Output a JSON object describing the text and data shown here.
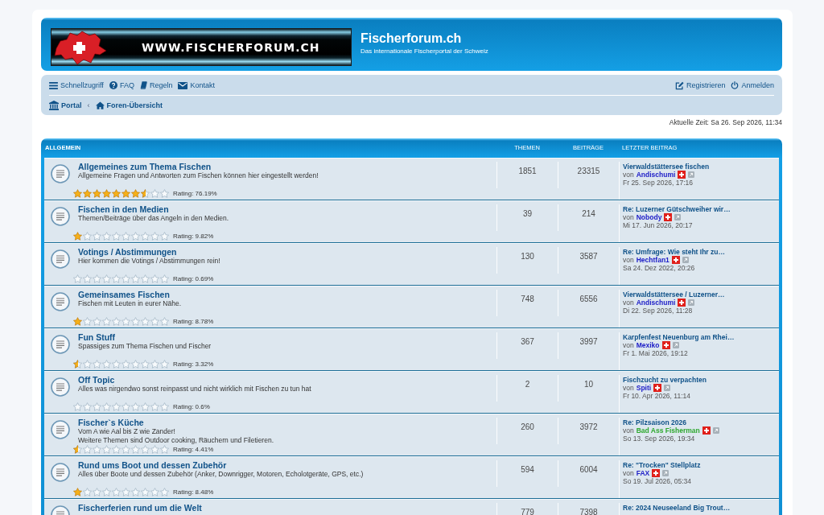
{
  "header": {
    "logo_text": "WWW.FISCHERFORUM.CH",
    "site_title": "Fischerforum.ch",
    "site_description": "Das internationale Fischerportal der Schweiz"
  },
  "navbar": {
    "left_links": [
      {
        "kind": "menu",
        "label": "Schnellzugriff"
      },
      {
        "kind": "faq",
        "label": "FAQ"
      },
      {
        "kind": "rules",
        "label": "Regeln"
      },
      {
        "kind": "contact",
        "label": "Kontakt"
      }
    ],
    "right_links": [
      {
        "kind": "register",
        "label": "Registrieren"
      },
      {
        "kind": "login",
        "label": "Anmelden"
      }
    ],
    "breadcrumbs": [
      {
        "kind": "portal",
        "label": "Portal"
      },
      {
        "kind": "home",
        "label": "Foren-Übersicht"
      }
    ],
    "breadcrumb_separator": "‹"
  },
  "current_time": "Aktuelle Zeit: Sa 26. Sep 2026, 11:34",
  "forum_list": {
    "category": "ALLGEMEIN",
    "columns": [
      "THEMEN",
      "BEITRÄGE",
      "LETZTER BEITRAG"
    ],
    "forums": [
      {
        "title": "Allgemeines zum Thema Fischen",
        "description": [
          "Allgemeine Fragen und Antworten zum Fischen können hier eingestellt werden!"
        ],
        "stars": 7.5,
        "rating": "Rating: 76.19%",
        "topics": "1851",
        "posts": "23315",
        "last_post": {
          "title": "Vierwaldstättersee fischen",
          "by": "von",
          "author": {
            "name": "Andischumi",
            "color": "#2020c8"
          },
          "date": "Fr 25. Sep 2026, 17:16"
        }
      },
      {
        "title": "Fischen in den Medien",
        "description": [
          "Themen/Beiträge über das Angeln in den Medien."
        ],
        "stars": 1,
        "rating": "Rating: 9.82%",
        "topics": "39",
        "posts": "214",
        "last_post": {
          "title": "Re: Luzerner Gütschweiher wir…",
          "by": "von",
          "author": {
            "name": "Nobody",
            "color": "#2020c8"
          },
          "date": "Mi 17. Jun 2026, 20:17"
        }
      },
      {
        "title": "Votings / Abstimmungen",
        "description": [
          "Hier kommen die Votings / Abstimmungen rein!"
        ],
        "stars": 0,
        "rating": "Rating: 0.69%",
        "topics": "130",
        "posts": "3587",
        "last_post": {
          "title": "Re: Umfrage: Wie steht Ihr zu…",
          "by": "von",
          "author": {
            "name": "Hechtfan1",
            "color": "#2020c8"
          },
          "date": "Sa 24. Dez 2022, 20:26"
        }
      },
      {
        "title": "Gemeinsames Fischen",
        "description": [
          "Fischen mit Leuten in eurer Nähe."
        ],
        "stars": 1,
        "rating": "Rating: 8.78%",
        "topics": "748",
        "posts": "6556",
        "last_post": {
          "title": "Vierwaldstättersee / Luzerner…",
          "by": "von",
          "author": {
            "name": "Andischumi",
            "color": "#2020c8"
          },
          "date": "Di 22. Sep 2026, 11:28"
        }
      },
      {
        "title": "Fun Stuff",
        "description": [
          "Spassiges zum Thema Fischen und Fischer"
        ],
        "stars": 0.5,
        "rating": "Rating: 3.32%",
        "topics": "367",
        "posts": "3997",
        "last_post": {
          "title": "Karpfenfest Neuenburg am Rhei…",
          "by": "von",
          "author": {
            "name": "Mexiko",
            "color": "#2020c8"
          },
          "date": "Fr 1. Mai 2026, 19:12"
        }
      },
      {
        "title": "Off Topic",
        "description": [
          "Alles was nirgendwo sonst reinpasst und nicht wirklich mit Fischen zu tun hat"
        ],
        "stars": 0,
        "rating": "Rating: 0.6%",
        "topics": "2",
        "posts": "10",
        "last_post": {
          "title": "Fischzucht zu verpachten",
          "by": "von",
          "author": {
            "name": "Spiti",
            "color": "#2020c8"
          },
          "date": "Fr 10. Apr 2026, 11:14"
        }
      },
      {
        "title": "Fischer`s Küche",
        "description": [
          "Vom A wie Aal bis Z wie Zander!",
          "Weitere Themen sind Outdoor cooking, Räuchern und Filetieren."
        ],
        "stars": 0.5,
        "rating": "Rating: 4.41%",
        "topics": "260",
        "posts": "3972",
        "last_post": {
          "title": "Re: Pilzsaison 2026",
          "by": "von",
          "author": {
            "name": "Bad Ass Fisherman",
            "color": "#2ea82e"
          },
          "date": "So 13. Sep 2026, 19:34"
        }
      },
      {
        "title": "Rund ums Boot und dessen Zubehör",
        "description": [
          "Alles über Boote und dessen Zubehör (Anker, Downrigger, Motoren, Echolotgeräte, GPS, etc.)"
        ],
        "stars": 1,
        "rating": "Rating: 8.48%",
        "topics": "594",
        "posts": "6004",
        "last_post": {
          "title": "Re: \"Trocken\" Stellplatz",
          "by": "von",
          "author": {
            "name": "FAX",
            "color": "#2020c8"
          },
          "date": "So 19. Jul 2026, 05:34"
        }
      },
      {
        "title": "Fischerferien rund um die Welt",
        "topics": "779",
        "posts": "7398",
        "last_post": {
          "title": "Re: 2024 Neuseeland Big Trout…"
        }
      }
    ]
  }
}
